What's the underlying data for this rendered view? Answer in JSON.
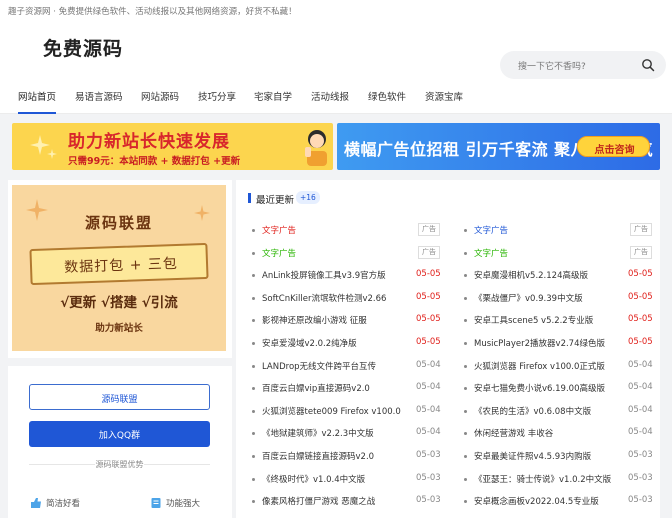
{
  "topbar": {
    "text": "趣子资源网 · 免费提供绿色软件、活动线报以及其他网络资源，好货不私藏！"
  },
  "header": {
    "logo": "免费源码"
  },
  "search": {
    "placeholder": "搜一下它不香吗?",
    "icon": "search-icon"
  },
  "nav": {
    "items": [
      {
        "label": "网站首页",
        "active": true
      },
      {
        "label": "易语言源码"
      },
      {
        "label": "网站源码"
      },
      {
        "label": "技巧分享"
      },
      {
        "label": "宅家自学"
      },
      {
        "label": "活动线报"
      },
      {
        "label": "绿色软件"
      },
      {
        "label": "资源宝库"
      }
    ]
  },
  "banners": {
    "left": {
      "title": "助力新站长快速发展",
      "subtitle": "只需99元：本站同款 + 数据打包 +更新"
    },
    "right": {
      "title": "横幅广告位招租 引万千客流 聚八方之财气",
      "cta": "点击咨询"
    }
  },
  "poster": {
    "title": "源码联盟",
    "plate": "数据打包 + 三包",
    "line2": "√更新 √搭建 √引流",
    "line3": "助力新站长"
  },
  "sidebar": {
    "btn1": "源码联盟",
    "btn2": "加入QQ群",
    "sep": "源码联盟优势",
    "feat1": "简洁好看",
    "feat2": "功能强大"
  },
  "main": {
    "title": "最近更新",
    "badge": "+16",
    "ad_tag": "广告",
    "ad_colors": {
      "red": "#e0201b",
      "green": "#27b400",
      "blue": "#1f57d6"
    },
    "left": [
      {
        "text": "文字广告",
        "ad": true,
        "color": "red"
      },
      {
        "text": "文字广告",
        "ad": true,
        "color": "green"
      },
      {
        "text": "AnLink投屏镜像工具v3.9官方版",
        "date": "05-05",
        "hot": true
      },
      {
        "text": "SoftCnKiller流氓软件检测v2.66",
        "date": "05-05",
        "hot": true
      },
      {
        "text": "影视神还原改编小游戏 征服",
        "date": "05-05",
        "hot": true
      },
      {
        "text": "安卓爱漫域v2.0.2纯净版",
        "date": "05-05",
        "hot": true
      },
      {
        "text": "LANDrop无线文件跨平台互传",
        "date": "05-04"
      },
      {
        "text": "百度云白嫖vip直接源码v2.0",
        "date": "05-04"
      },
      {
        "text": "火狐浏览器tete009 Firefox v100.0",
        "date": "05-04"
      },
      {
        "text": "《地狱建筑师》v2.2.3中文版",
        "date": "05-04"
      },
      {
        "text": "百度云白嫖链接直接源码v2.0",
        "date": "05-03"
      },
      {
        "text": "《终极时代》v1.0.4中文版",
        "date": "05-03"
      },
      {
        "text": "像素风格打僵尸游戏 恶魔之战",
        "date": "05-03"
      }
    ],
    "right": [
      {
        "text": "文字广告",
        "ad": true,
        "color": "blue"
      },
      {
        "text": "文字广告",
        "ad": true,
        "color": "green"
      },
      {
        "text": "安卓魔漫相机v5.2.124高级版",
        "date": "05-05",
        "hot": true
      },
      {
        "text": "《栗战僵尸》v0.9.39中文版",
        "date": "05-05",
        "hot": true
      },
      {
        "text": "安卓工具scene5 v5.2.2专业版",
        "date": "05-05",
        "hot": true
      },
      {
        "text": "MusicPlayer2播放器v2.74绿色版",
        "date": "05-05",
        "hot": true
      },
      {
        "text": "火狐浏览器 Firefox v100.0正式版",
        "date": "05-04"
      },
      {
        "text": "安卓七猫免费小说v6.19.00高级版",
        "date": "05-04"
      },
      {
        "text": "《农民的生活》v0.6.08中文版",
        "date": "05-04"
      },
      {
        "text": "休闲经营游戏 丰收谷",
        "date": "05-04"
      },
      {
        "text": "安卓最美证件照v4.5.93内购版",
        "date": "05-03"
      },
      {
        "text": "《亚瑟王：骑士传说》v1.0.2中文版",
        "date": "05-03"
      },
      {
        "text": "安卓概念画板v2022.04.5专业版",
        "date": "05-03"
      }
    ]
  }
}
